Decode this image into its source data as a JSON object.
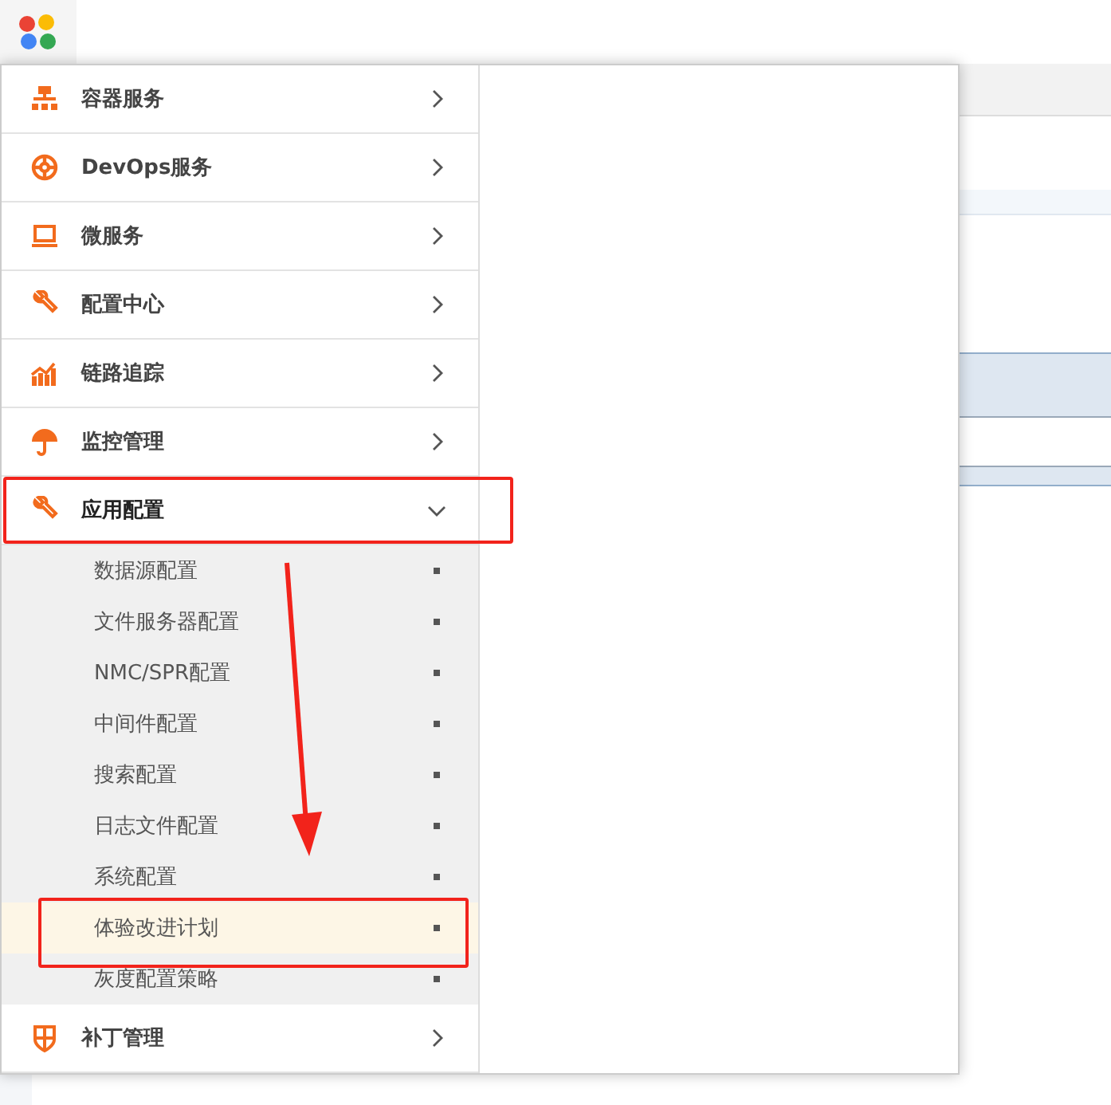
{
  "menu": [
    {
      "label": "容器服务",
      "expanded": false
    },
    {
      "label": "DevOps服务",
      "expanded": false
    },
    {
      "label": "微服务",
      "expanded": false
    },
    {
      "label": "配置中心",
      "expanded": false
    },
    {
      "label": "链路追踪",
      "expanded": false
    },
    {
      "label": "监控管理",
      "expanded": false
    },
    {
      "label": "应用配置",
      "expanded": true,
      "children": [
        {
          "label": "数据源配置",
          "selected": false
        },
        {
          "label": "文件服务器配置",
          "selected": false
        },
        {
          "label": "NMC/SPR配置",
          "selected": false
        },
        {
          "label": "中间件配置",
          "selected": false
        },
        {
          "label": "搜索配置",
          "selected": false
        },
        {
          "label": "日志文件配置",
          "selected": false
        },
        {
          "label": "系统配置",
          "selected": false
        },
        {
          "label": "体验改进计划",
          "selected": true
        },
        {
          "label": "灰度配置策略",
          "selected": false
        }
      ]
    },
    {
      "label": "补丁管理",
      "expanded": false
    }
  ]
}
